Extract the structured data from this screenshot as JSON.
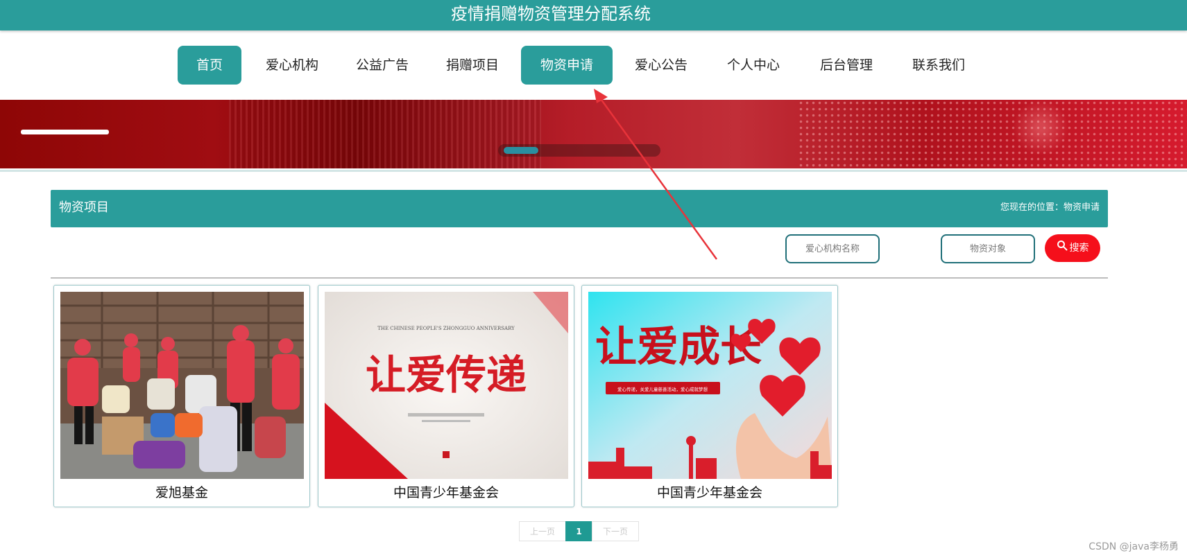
{
  "site": {
    "title": "疫情捐赠物资管理分配系统"
  },
  "nav": {
    "items": [
      {
        "label": "首页",
        "active": true
      },
      {
        "label": "爱心机构",
        "active": false
      },
      {
        "label": "公益广告",
        "active": false
      },
      {
        "label": "捐赠项目",
        "active": false
      },
      {
        "label": "物资申请",
        "active": true
      },
      {
        "label": "爱心公告",
        "active": false
      },
      {
        "label": "个人中心",
        "active": false
      },
      {
        "label": "后台管理",
        "active": false
      },
      {
        "label": "联系我们",
        "active": false
      }
    ]
  },
  "section": {
    "title": "物资项目",
    "breadcrumb": "您现在的位置：物资申请"
  },
  "search": {
    "org_placeholder": "爱心机构名称",
    "target_placeholder": "物资对象",
    "button_label": "搜索"
  },
  "cards": [
    {
      "caption": "爱旭基金",
      "image_text": ""
    },
    {
      "caption": "中国青少年基金会",
      "image_text": "让爱传递",
      "image_subtext": "THE CHINESE PEOPLE'S ZHONGGUO ANNIVERSARY"
    },
    {
      "caption": "中国青少年基金会",
      "image_text": "让爱成长",
      "image_subtext": "爱心传递，关爱儿童慈善活动，爱心成就梦想"
    }
  ],
  "pagination": {
    "prev": "上一页",
    "current": "1",
    "next": "下一页"
  },
  "watermark": "CSDN @java李杨勇",
  "colors": {
    "primary": "#2a9d9b",
    "search_button": "#f50f1b",
    "annotation_arrow": "#e8333a"
  }
}
